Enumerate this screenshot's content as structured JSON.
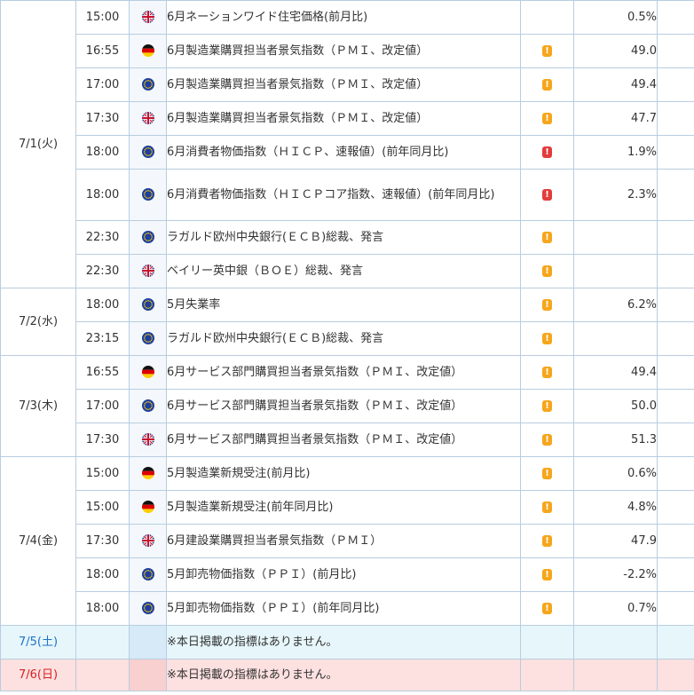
{
  "days": [
    {
      "date": "7/1(火)",
      "events": [
        {
          "time": "15:00",
          "flag": "uk-flag",
          "event": "6月ネーションワイド住宅価格(前月比)",
          "importance": "",
          "result": "0.5%"
        },
        {
          "time": "16:55",
          "flag": "germany-flag",
          "event": "6月製造業購買担当者景気指数（ＰＭＩ、改定値）",
          "importance": "mid",
          "result": "49.0"
        },
        {
          "time": "17:00",
          "flag": "eu-flag",
          "event": "6月製造業購買担当者景気指数（ＰＭＩ、改定値）",
          "importance": "mid",
          "result": "49.4"
        },
        {
          "time": "17:30",
          "flag": "uk-flag",
          "event": "6月製造業購買担当者景気指数（ＰＭＩ、改定値）",
          "importance": "mid",
          "result": "47.7"
        },
        {
          "time": "18:00",
          "flag": "eu-flag",
          "event": "6月消費者物価指数（ＨＩＣＰ、速報値）(前年同月比)",
          "importance": "high",
          "result": "1.9%"
        },
        {
          "time": "18:00",
          "flag": "eu-flag",
          "event": "6月消費者物価指数（ＨＩＣＰコア指数、速報値）(前年同月比)",
          "importance": "high",
          "result": "2.3%",
          "tall": true
        },
        {
          "time": "22:30",
          "flag": "eu-flag",
          "event": "ラガルド欧州中央銀行(ＥＣＢ)総裁、発言",
          "importance": "mid",
          "result": ""
        },
        {
          "time": "22:30",
          "flag": "uk-flag",
          "event": "ベイリー英中銀（ＢＯＥ）総裁、発言",
          "importance": "mid",
          "result": ""
        }
      ]
    },
    {
      "date": "7/2(水)",
      "events": [
        {
          "time": "18:00",
          "flag": "eu-flag",
          "event": "5月失業率",
          "importance": "mid",
          "result": "6.2%"
        },
        {
          "time": "23:15",
          "flag": "eu-flag",
          "event": "ラガルド欧州中央銀行(ＥＣＢ)総裁、発言",
          "importance": "mid",
          "result": ""
        }
      ]
    },
    {
      "date": "7/3(木)",
      "events": [
        {
          "time": "16:55",
          "flag": "germany-flag",
          "event": "6月サービス部門購買担当者景気指数（ＰＭＩ、改定値）",
          "importance": "mid",
          "result": "49.4"
        },
        {
          "time": "17:00",
          "flag": "eu-flag",
          "event": "6月サービス部門購買担当者景気指数（ＰＭＩ、改定値）",
          "importance": "mid",
          "result": "50.0"
        },
        {
          "time": "17:30",
          "flag": "uk-flag",
          "event": "6月サービス部門購買担当者景気指数（ＰＭＩ、改定値）",
          "importance": "mid",
          "result": "51.3"
        }
      ]
    },
    {
      "date": "7/4(金)",
      "events": [
        {
          "time": "15:00",
          "flag": "germany-flag",
          "event": "5月製造業新規受注(前月比)",
          "importance": "mid",
          "result": "0.6%"
        },
        {
          "time": "15:00",
          "flag": "germany-flag",
          "event": "5月製造業新規受注(前年同月比)",
          "importance": "mid",
          "result": "4.8%"
        },
        {
          "time": "17:30",
          "flag": "uk-flag",
          "event": "6月建設業購買担当者景気指数（ＰＭＩ）",
          "importance": "mid",
          "result": "47.9"
        },
        {
          "time": "18:00",
          "flag": "eu-flag",
          "event": "5月卸売物価指数（ＰＰＩ）(前月比)",
          "importance": "mid",
          "result": "-2.2%"
        },
        {
          "time": "18:00",
          "flag": "eu-flag",
          "event": "5月卸売物価指数（ＰＰＩ）(前年同月比)",
          "importance": "mid",
          "result": "0.7%"
        }
      ]
    },
    {
      "date": "7/5(土)",
      "weekend": "sat",
      "events": [
        {
          "time": "",
          "flag": "",
          "event": "※本日掲載の指標はありません。",
          "importance": "",
          "result": ""
        }
      ]
    },
    {
      "date": "7/6(日)",
      "weekend": "sun",
      "events": [
        {
          "time": "",
          "flag": "",
          "event": "※本日掲載の指標はありません。",
          "importance": "",
          "result": ""
        }
      ]
    }
  ],
  "badge_glyph": "!",
  "colors": {
    "mid": "#f6a61c",
    "high": "#e33c3c",
    "saturday": "#1e73c8",
    "sunday": "#d82020",
    "border": "#b8cde0"
  }
}
